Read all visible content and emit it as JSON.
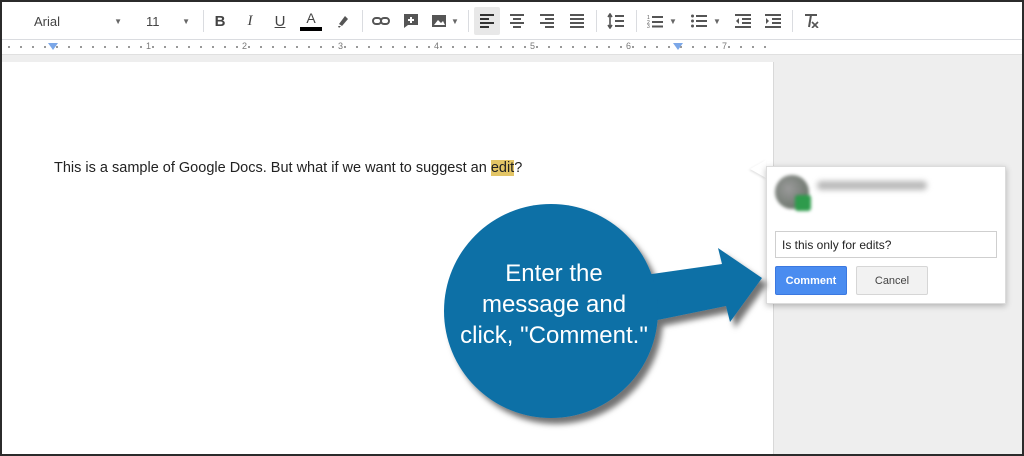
{
  "toolbar": {
    "font_name": "Arial",
    "font_size": "11",
    "icons": [
      "bold-icon",
      "italic-icon",
      "underline-icon",
      "text-color-icon",
      "highlight-icon",
      "link-icon",
      "add-comment-icon",
      "image-icon",
      "align-left-icon",
      "align-center-icon",
      "align-right-icon",
      "justify-icon",
      "line-spacing-icon",
      "numbered-list-icon",
      "bulleted-list-icon",
      "decrease-indent-icon",
      "increase-indent-icon",
      "clear-formatting-icon"
    ]
  },
  "ruler": {
    "numbers": [
      "1",
      "2",
      "3",
      "4",
      "5",
      "6",
      "7"
    ]
  },
  "document": {
    "text_before": "This is a sample of Google Docs. But what if we want to suggest an ",
    "highlighted": "edit",
    "text_after": "?"
  },
  "comment": {
    "input_value": "Is this only for edits?",
    "comment_label": "Comment",
    "cancel_label": "Cancel"
  },
  "callout": {
    "line1": "Enter the",
    "line2": "message and",
    "line3": "click, \"Comment.\"",
    "color": "#0f6fa6"
  }
}
